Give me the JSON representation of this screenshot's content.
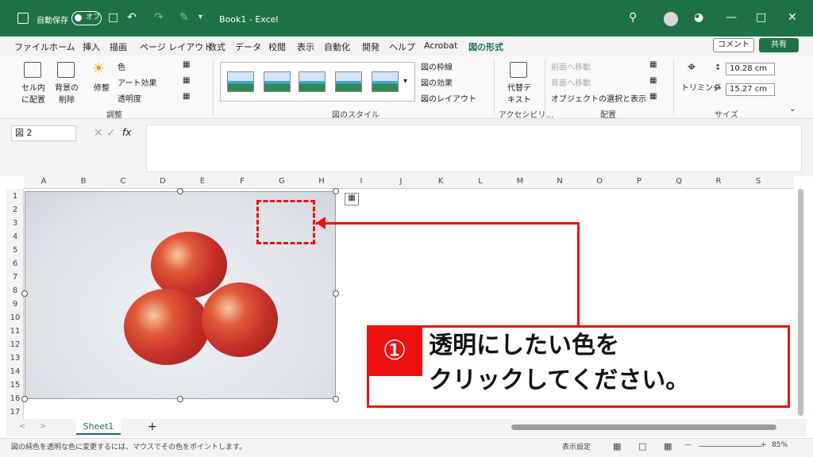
{
  "titlebar": {
    "autosave_label": "自動保存",
    "autosave_state": "オフ",
    "title": "Book1  -  Excel"
  },
  "tabs": [
    "ファイル",
    "ホーム",
    "挿入",
    "描画",
    "ページ レイアウト",
    "数式",
    "データ",
    "校閲",
    "表示",
    "自動化",
    "開発",
    "ヘルプ",
    "Acrobat",
    "図の形式"
  ],
  "active_tab": "図の形式",
  "comment_label": "コメント",
  "share_label": "共有",
  "ribbon": {
    "cell_place": "セル内に配置",
    "bg_remove": "背景の削除",
    "correct": "修整",
    "color": "色",
    "art_effect": "アート効果",
    "transparency": "透明度",
    "group_adjust": "調整",
    "pic_border": "図の枠線",
    "pic_effect": "図の効果",
    "pic_layout": "図のレイアウト",
    "group_styles": "図のスタイル",
    "alt_text": "代替テキスト",
    "group_access": "アクセシビリ…",
    "bring_forward": "前面へ移動",
    "send_backward": "背面へ移動",
    "selection_pane": "オブジェクトの選択と表示",
    "group_arrange": "配置",
    "crop": "トリミング",
    "height": "10.28 cm",
    "width": "15.27 cm",
    "group_size": "サイズ"
  },
  "formula": {
    "namebox": "図 2",
    "fx": "fx"
  },
  "columns": [
    "A",
    "B",
    "C",
    "D",
    "E",
    "F",
    "G",
    "H",
    "I",
    "J",
    "K",
    "L",
    "M",
    "N",
    "O",
    "P",
    "Q",
    "R",
    "S"
  ],
  "rows": [
    "1",
    "2",
    "3",
    "4",
    "5",
    "6",
    "7",
    "8",
    "9",
    "10",
    "11",
    "12",
    "13",
    "14",
    "15",
    "16",
    "17"
  ],
  "callout": {
    "number": "①",
    "line1": "透明にしたい色を",
    "line2": "クリックしてください。"
  },
  "sheet": {
    "name": "Sheet1",
    "add": "+"
  },
  "status": {
    "message": "図の純色を透明な色に変更するには、マウスでその色をポイントします。",
    "display_settings": "表示設定",
    "zoom": "85%"
  }
}
